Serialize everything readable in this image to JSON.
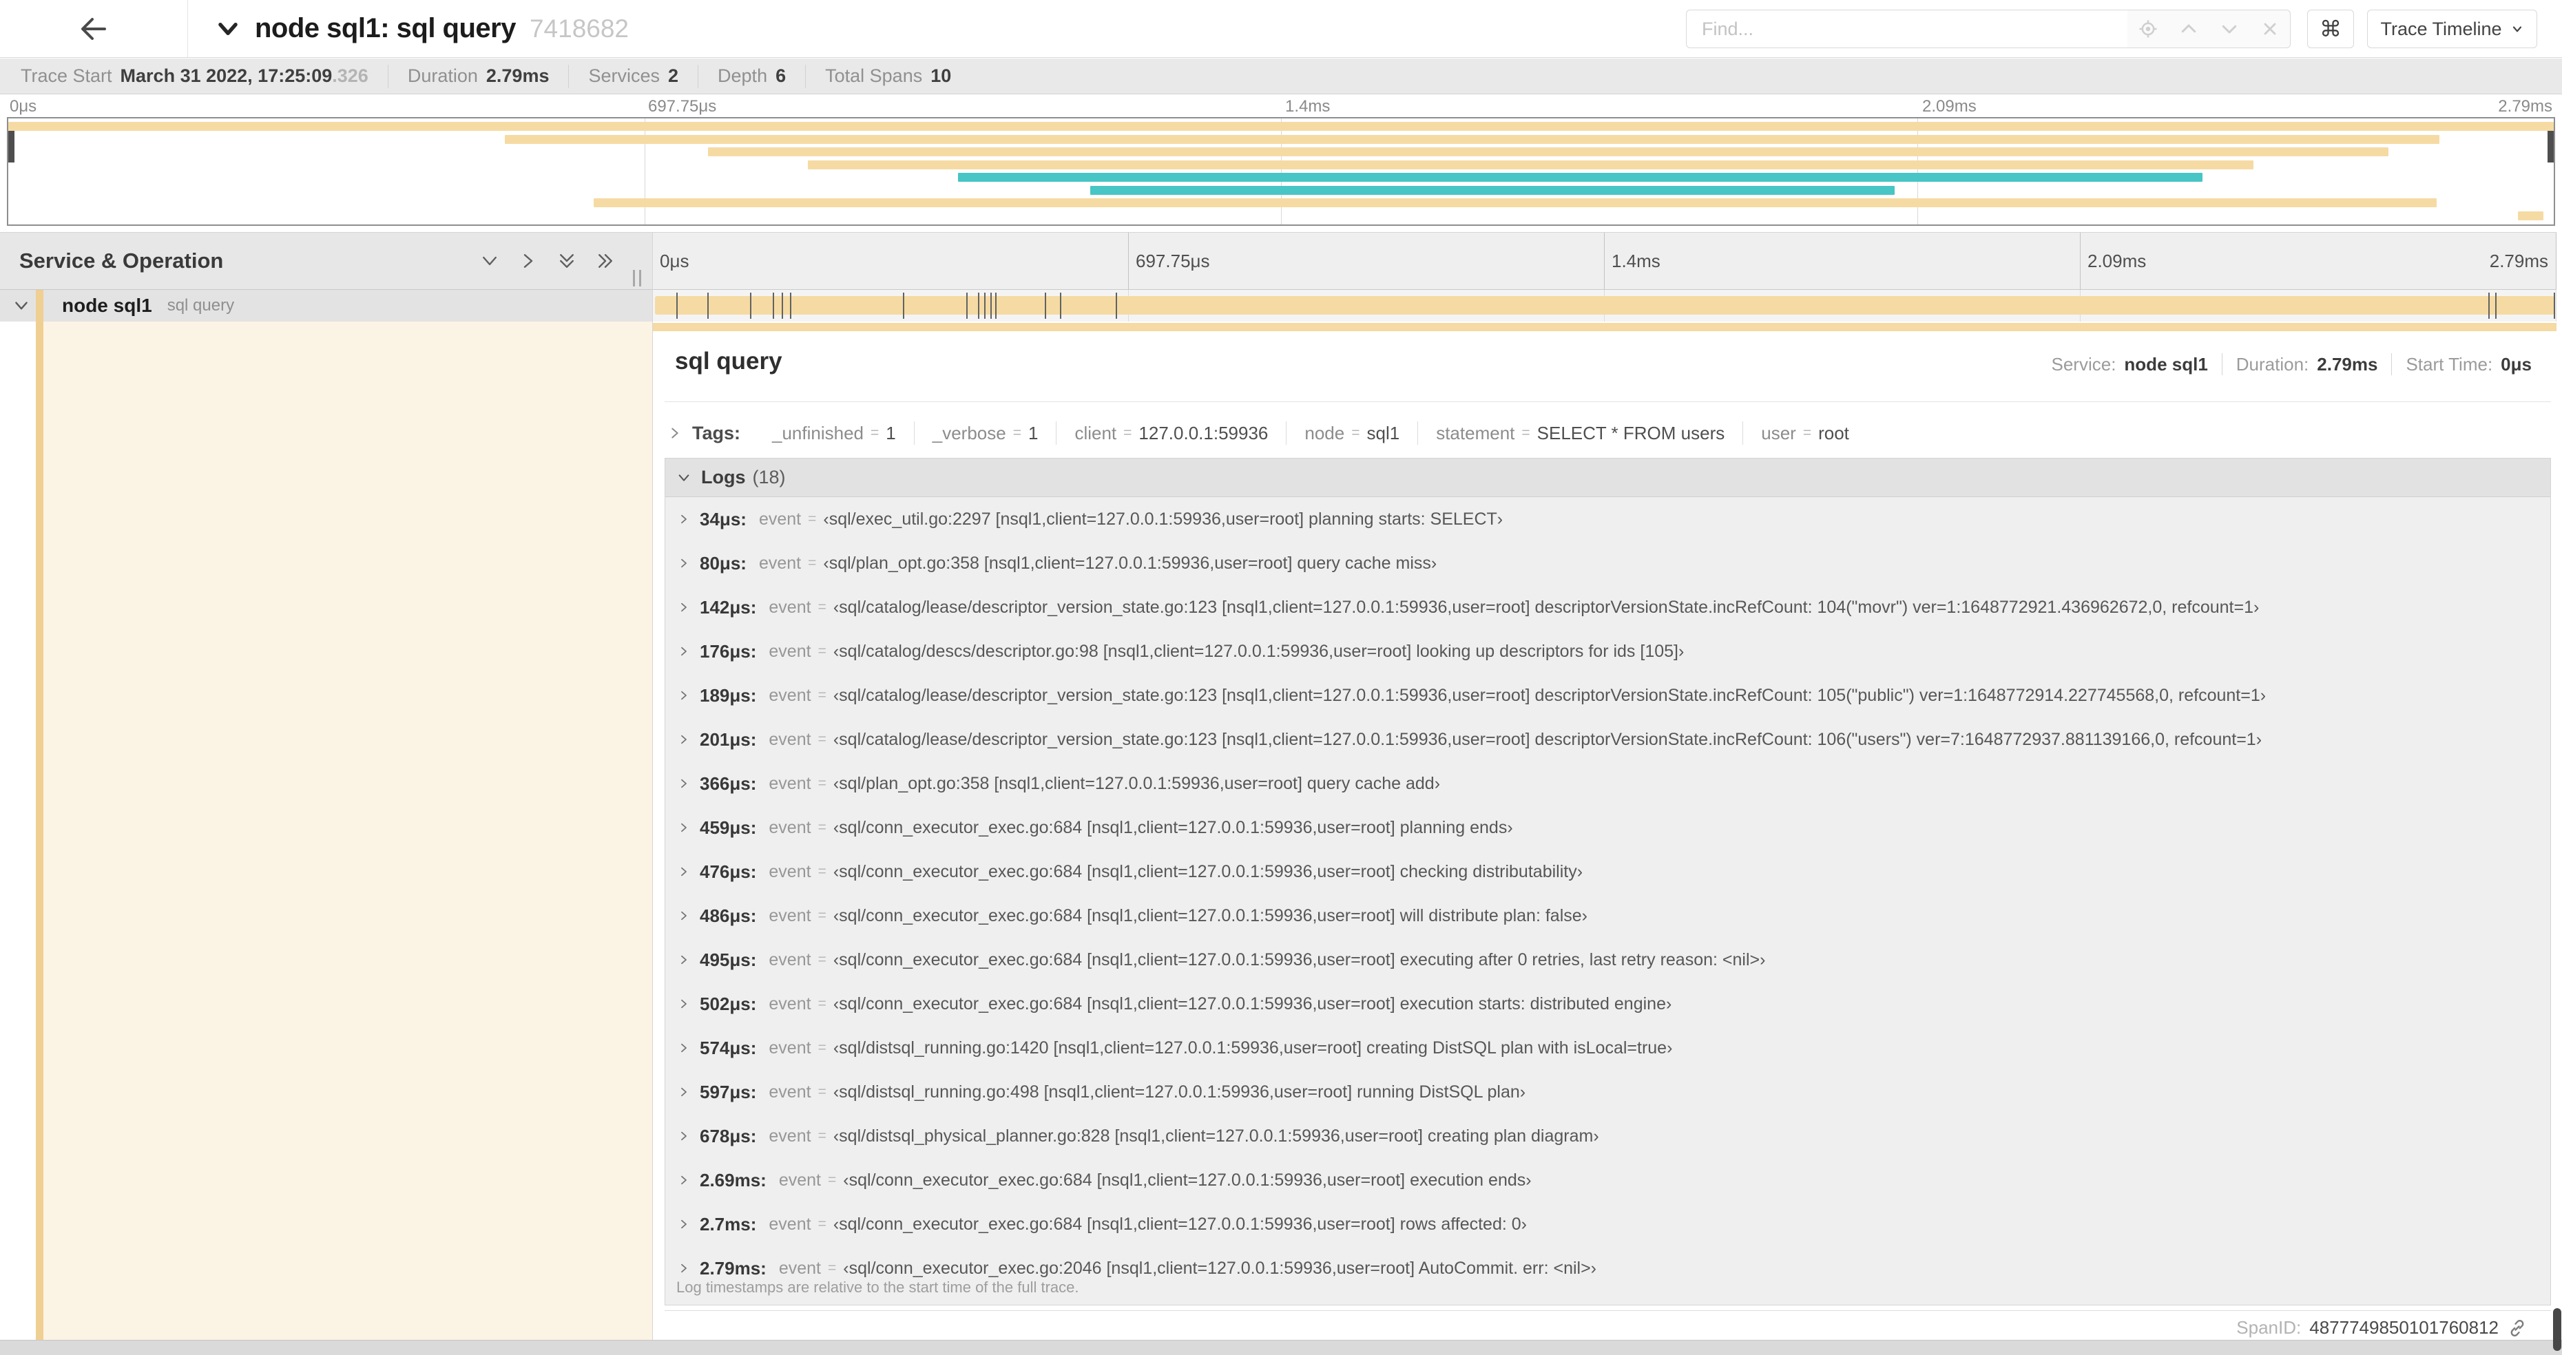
{
  "header": {
    "title": "node sql1: sql query",
    "trace_id": "7418682",
    "find_placeholder": "Find...",
    "shortcut_key": "⌘",
    "view_button": "Trace Timeline"
  },
  "summary": {
    "items": [
      {
        "label": "Trace Start",
        "value": "March 31 2022, 17:25:09",
        "suffix": ".326"
      },
      {
        "label": "Duration",
        "value": "2.79ms",
        "suffix": ""
      },
      {
        "label": "Services",
        "value": "2",
        "suffix": ""
      },
      {
        "label": "Depth",
        "value": "6",
        "suffix": ""
      },
      {
        "label": "Total Spans",
        "value": "10",
        "suffix": ""
      }
    ]
  },
  "colors": {
    "tan": "#f5dba3",
    "teal": "#48c5c5",
    "accent": "#f0cf93",
    "cream": "#fbf3e4"
  },
  "minimap": {
    "ticks": [
      {
        "pos": 0,
        "label": "0μs"
      },
      {
        "pos": 25,
        "label": "697.75μs"
      },
      {
        "pos": 50,
        "label": "1.4ms"
      },
      {
        "pos": 75,
        "label": "2.09ms"
      },
      {
        "pos": 100,
        "label": "2.79ms"
      }
    ],
    "spans": [
      {
        "start": 0,
        "end": 100,
        "color": "tan"
      },
      {
        "start": 19.5,
        "end": 95.5,
        "color": "tan"
      },
      {
        "start": 27.5,
        "end": 93.5,
        "color": "tan"
      },
      {
        "start": 31.4,
        "end": 88.2,
        "color": "tan"
      },
      {
        "start": 37.3,
        "end": 86.2,
        "color": "teal"
      },
      {
        "start": 42.5,
        "end": 74.1,
        "color": "teal"
      },
      {
        "start": 23.0,
        "end": 95.4,
        "color": "tan"
      },
      {
        "start": 98.6,
        "end": 99.6,
        "color": "tan"
      }
    ]
  },
  "timeline": {
    "column_header": "Service & Operation",
    "ticks": [
      {
        "pos": 0,
        "label": "0μs"
      },
      {
        "pos": 25,
        "label": "697.75μs"
      },
      {
        "pos": 50,
        "label": "1.4ms"
      },
      {
        "pos": 75,
        "label": "2.09ms"
      },
      {
        "pos": 100,
        "label": "2.79ms"
      }
    ],
    "row": {
      "service": "node sql1",
      "operation": "sql query"
    },
    "duration_us": 2790,
    "log_tick_us": [
      34,
      80,
      142,
      176,
      189,
      201,
      366,
      459,
      476,
      486,
      495,
      502,
      574,
      597,
      678,
      2690,
      2700,
      2786
    ]
  },
  "detail": {
    "title": "sql query",
    "meta": [
      {
        "label": "Service:",
        "value": "node sql1"
      },
      {
        "label": "Duration:",
        "value": "2.79ms"
      },
      {
        "label": "Start Time:",
        "value": "0μs"
      }
    ],
    "tags_label": "Tags:",
    "tags": [
      {
        "key": "_unfinished",
        "value": "1"
      },
      {
        "key": "_verbose",
        "value": "1"
      },
      {
        "key": "client",
        "value": "127.0.0.1:59936"
      },
      {
        "key": "node",
        "value": "sql1"
      },
      {
        "key": "statement",
        "value": "SELECT * FROM users"
      },
      {
        "key": "user",
        "value": "root"
      }
    ],
    "logs_label": "Logs",
    "logs_count": "(18)",
    "logs": [
      {
        "time": "34μs:",
        "field": "event",
        "value": "‹sql/exec_util.go:2297 [nsql1,client=127.0.0.1:59936,user=root] planning starts: SELECT›"
      },
      {
        "time": "80μs:",
        "field": "event",
        "value": "‹sql/plan_opt.go:358 [nsql1,client=127.0.0.1:59936,user=root] query cache miss›"
      },
      {
        "time": "142μs:",
        "field": "event",
        "value": "‹sql/catalog/lease/descriptor_version_state.go:123 [nsql1,client=127.0.0.1:59936,user=root] descriptorVersionState.incRefCount: 104(\"movr\") ver=1:1648772921.436962672,0, refcount=1›"
      },
      {
        "time": "176μs:",
        "field": "event",
        "value": "‹sql/catalog/descs/descriptor.go:98 [nsql1,client=127.0.0.1:59936,user=root] looking up descriptors for ids [105]›"
      },
      {
        "time": "189μs:",
        "field": "event",
        "value": "‹sql/catalog/lease/descriptor_version_state.go:123 [nsql1,client=127.0.0.1:59936,user=root] descriptorVersionState.incRefCount: 105(\"public\") ver=1:1648772914.227745568,0, refcount=1›"
      },
      {
        "time": "201μs:",
        "field": "event",
        "value": "‹sql/catalog/lease/descriptor_version_state.go:123 [nsql1,client=127.0.0.1:59936,user=root] descriptorVersionState.incRefCount: 106(\"users\") ver=7:1648772937.881139166,0, refcount=1›"
      },
      {
        "time": "366μs:",
        "field": "event",
        "value": "‹sql/plan_opt.go:358 [nsql1,client=127.0.0.1:59936,user=root] query cache add›"
      },
      {
        "time": "459μs:",
        "field": "event",
        "value": "‹sql/conn_executor_exec.go:684 [nsql1,client=127.0.0.1:59936,user=root] planning ends›"
      },
      {
        "time": "476μs:",
        "field": "event",
        "value": "‹sql/conn_executor_exec.go:684 [nsql1,client=127.0.0.1:59936,user=root] checking distributability›"
      },
      {
        "time": "486μs:",
        "field": "event",
        "value": "‹sql/conn_executor_exec.go:684 [nsql1,client=127.0.0.1:59936,user=root] will distribute plan: false›"
      },
      {
        "time": "495μs:",
        "field": "event",
        "value": "‹sql/conn_executor_exec.go:684 [nsql1,client=127.0.0.1:59936,user=root] executing after 0 retries, last retry reason: <nil>›"
      },
      {
        "time": "502μs:",
        "field": "event",
        "value": "‹sql/conn_executor_exec.go:684 [nsql1,client=127.0.0.1:59936,user=root] execution starts: distributed engine›"
      },
      {
        "time": "574μs:",
        "field": "event",
        "value": "‹sql/distsql_running.go:1420 [nsql1,client=127.0.0.1:59936,user=root] creating DistSQL plan with isLocal=true›"
      },
      {
        "time": "597μs:",
        "field": "event",
        "value": "‹sql/distsql_running.go:498 [nsql1,client=127.0.0.1:59936,user=root] running DistSQL plan›"
      },
      {
        "time": "678μs:",
        "field": "event",
        "value": "‹sql/distsql_physical_planner.go:828 [nsql1,client=127.0.0.1:59936,user=root] creating plan diagram›"
      },
      {
        "time": "2.69ms:",
        "field": "event",
        "value": "‹sql/conn_executor_exec.go:684 [nsql1,client=127.0.0.1:59936,user=root] execution ends›"
      },
      {
        "time": "2.7ms:",
        "field": "event",
        "value": "‹sql/conn_executor_exec.go:684 [nsql1,client=127.0.0.1:59936,user=root] rows affected: 0›"
      },
      {
        "time": "2.79ms:",
        "field": "event",
        "value": "‹sql/conn_executor_exec.go:2046 [nsql1,client=127.0.0.1:59936,user=root] AutoCommit. err: <nil>›"
      }
    ],
    "footnote": "Log timestamps are relative to the start time of the full trace.",
    "span_id_label": "SpanID:",
    "span_id": "4877749850101760812"
  }
}
